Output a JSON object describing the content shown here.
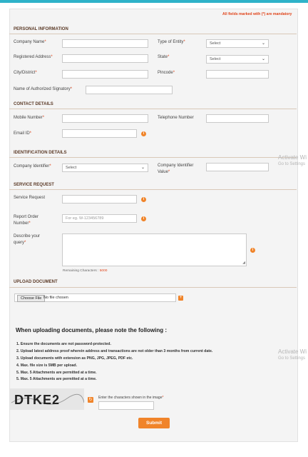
{
  "mandatory_note": "All fields marked with (*) are mandatory",
  "sections": {
    "personal": "PERSONAL INFORMATION",
    "contact": "CONTACT DETAILS",
    "identification": "IDENTIFICATION DETAILS",
    "service": "SERVICE REQUEST",
    "upload": "UPLOAD DOCUMENT"
  },
  "fields": {
    "company_name": "Company Name",
    "type_of_entity": "Type of Entity",
    "type_of_entity_value": "Select",
    "registered_address": "Registered Address",
    "state": "State",
    "state_value": "Select",
    "city": "City/District",
    "pincode": "Pincode",
    "authorized_signatory": "Name of Authorized Signatory",
    "mobile": "Mobile Number",
    "telephone": "Telephone Number",
    "email": "Email ID",
    "company_identifier": "Company Identifier",
    "company_identifier_value": "Select",
    "company_identifier_value_label_1": "Company Identifier",
    "company_identifier_value_label_2": "Value",
    "service_request": "Service Request",
    "report_order_1": "Report Order",
    "report_order_2": "Number",
    "report_order_placeholder": "For eg. W-123456789",
    "describe_1": "Describe your",
    "describe_2": "query",
    "remaining_label": "Remaining Characters :",
    "remaining_value": "5000"
  },
  "upload": {
    "choose_file": "Choose File",
    "no_file": "No file chosen"
  },
  "notes": {
    "title": "When uploading documents, please note the following :",
    "items": [
      "1. Ensure the documents are not password-protected.",
      "2. Upload latest address proof wherein address and transactions are not older than 3 months from current date.",
      "3. Upload documents with extension as PNG, JPG, JPEG, PDF etc.",
      "4. Max. file size is 5MB per upload.",
      "5. Max. 5 Attachments are permitted at a time.",
      "5. Max. 5 Attachments are permitted at a time."
    ]
  },
  "captcha": {
    "text": "DTKE2",
    "prompt": "Enter the characters shown in the image"
  },
  "submit_label": "Submit",
  "watermark": {
    "line1": "Activate Wi",
    "line2": "Go to Settings"
  }
}
